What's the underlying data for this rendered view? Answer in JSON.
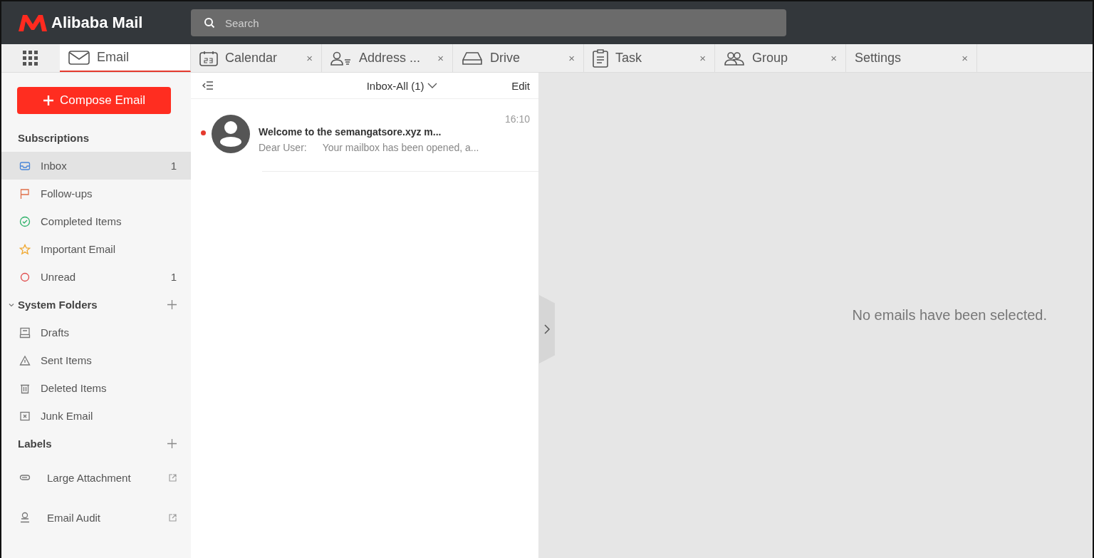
{
  "brand": {
    "name": "Alibaba Mail"
  },
  "search": {
    "placeholder": "Search"
  },
  "tabs": [
    {
      "label": "Email",
      "kind": "mail",
      "selected": true
    },
    {
      "label": "Calendar",
      "kind": "calendar",
      "selected": false,
      "close": "×"
    },
    {
      "label": "Address ...",
      "kind": "contacts",
      "selected": false,
      "close": "×"
    },
    {
      "label": "Drive",
      "kind": "drive",
      "selected": false,
      "close": "×"
    },
    {
      "label": "Task",
      "kind": "task",
      "selected": false,
      "close": "×"
    },
    {
      "label": "Group",
      "kind": "group",
      "selected": false,
      "close": "×"
    },
    {
      "label": "Settings",
      "kind": "settings",
      "selected": false,
      "close": "×"
    }
  ],
  "compose": {
    "label": "Compose Email"
  },
  "sidebar": {
    "sections": [
      {
        "title": "Subscriptions",
        "kind": "plain",
        "items": [
          {
            "label": "Inbox",
            "kind": "inbox",
            "count": "1",
            "selected": true
          },
          {
            "label": "Follow-ups",
            "kind": "flag",
            "selected": false
          },
          {
            "label": "Completed Items",
            "kind": "check",
            "selected": false
          },
          {
            "label": "Important Email",
            "kind": "star",
            "selected": false
          },
          {
            "label": "Unread",
            "kind": "circle",
            "count": "1",
            "selected": false
          }
        ]
      },
      {
        "title": "System Folders",
        "kind": "folders",
        "expanded": true,
        "items": [
          {
            "label": "Drafts",
            "kind": "drafts",
            "selected": false
          },
          {
            "label": "Sent Items",
            "kind": "sent",
            "selected": false
          },
          {
            "label": "Deleted Items",
            "kind": "trash",
            "selected": false
          },
          {
            "label": "Junk Email",
            "kind": "junk",
            "selected": false
          }
        ]
      },
      {
        "title": "Labels",
        "kind": "labels",
        "items": [
          {
            "label": "Large Attachment",
            "kind": "clip",
            "selected": false
          },
          {
            "label": "Email Audit",
            "kind": "audit",
            "selected": false
          }
        ]
      }
    ]
  },
  "mail_list": {
    "folder": "Inbox-All (1)",
    "edit": "Edit",
    "messages": [
      {
        "unread": true,
        "time": "16:10",
        "subject": "Welcome to the semangatsore.xyz m...",
        "from": "Dear User:",
        "preview": "Your mailbox has been opened, a..."
      }
    ]
  },
  "preview_pane": {
    "empty_text": "No emails have been selected."
  }
}
